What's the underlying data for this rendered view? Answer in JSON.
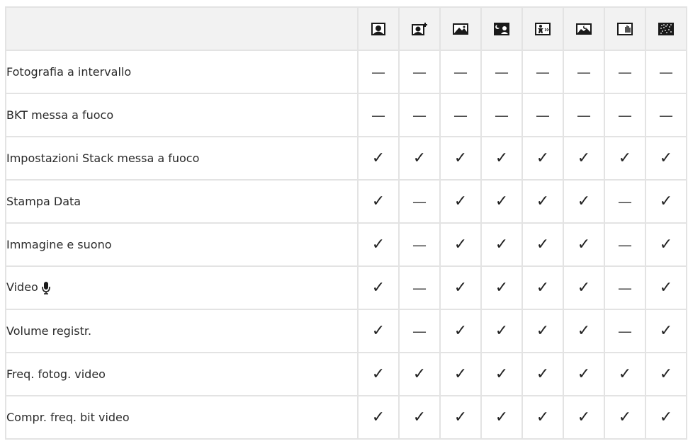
{
  "header": {
    "modes": [
      {
        "icon": "portrait-mode-icon"
      },
      {
        "icon": "e-portrait-mode-icon"
      },
      {
        "icon": "landscape-mode-icon"
      },
      {
        "icon": "night-portrait-mode-icon"
      },
      {
        "icon": "children-sports-mode-icon"
      },
      {
        "icon": "night-scene-mode-icon"
      },
      {
        "icon": "handheld-night-mode-icon"
      },
      {
        "icon": "fireworks-mode-icon"
      }
    ]
  },
  "symbols": {
    "yes": "✓",
    "no": "—"
  },
  "rows": [
    {
      "label": "Fotografia a intervallo",
      "support": [
        "—",
        "—",
        "—",
        "—",
        "—",
        "—",
        "—",
        "—"
      ]
    },
    {
      "label": "BKT messa a fuoco",
      "support": [
        "—",
        "—",
        "—",
        "—",
        "—",
        "—",
        "—",
        "—"
      ]
    },
    {
      "label": "Impostazioni Stack messa a fuoco",
      "support": [
        "✓",
        "✓",
        "✓",
        "✓",
        "✓",
        "✓",
        "✓",
        "✓"
      ]
    },
    {
      "label": "Stampa Data",
      "support": [
        "✓",
        "—",
        "✓",
        "✓",
        "✓",
        "✓",
        "—",
        "✓"
      ]
    },
    {
      "label": "Immagine e suono",
      "support": [
        "✓",
        "—",
        "✓",
        "✓",
        "✓",
        "✓",
        "—",
        "✓"
      ]
    },
    {
      "label": "Video",
      "label_icon": "microphone-icon",
      "support": [
        "✓",
        "—",
        "✓",
        "✓",
        "✓",
        "✓",
        "—",
        "✓"
      ]
    },
    {
      "label": "Volume registr.",
      "support": [
        "✓",
        "—",
        "✓",
        "✓",
        "✓",
        "✓",
        "—",
        "✓"
      ]
    },
    {
      "label": "Freq. fotog. video",
      "support": [
        "✓",
        "✓",
        "✓",
        "✓",
        "✓",
        "✓",
        "✓",
        "✓"
      ]
    },
    {
      "label": "Compr. freq. bit video",
      "support": [
        "✓",
        "✓",
        "✓",
        "✓",
        "✓",
        "✓",
        "✓",
        "✓"
      ]
    }
  ]
}
